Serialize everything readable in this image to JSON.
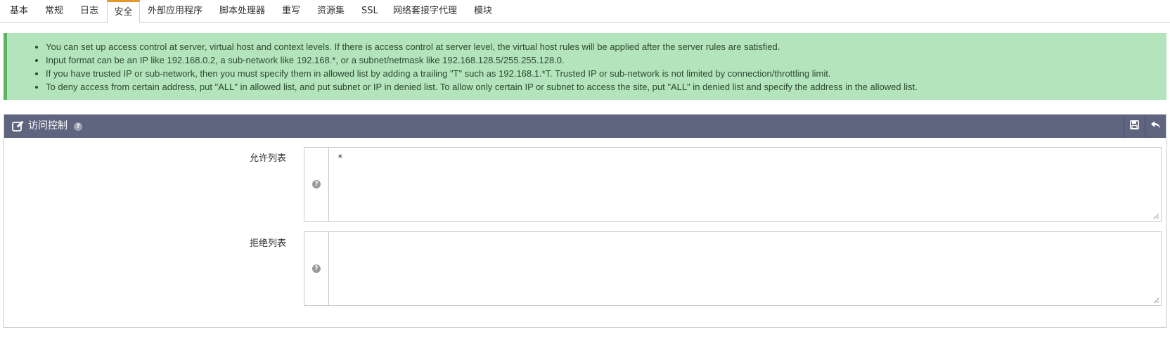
{
  "tabs": [
    {
      "label": "基本"
    },
    {
      "label": "常规"
    },
    {
      "label": "日志"
    },
    {
      "label": "安全"
    },
    {
      "label": "外部应用程序"
    },
    {
      "label": "脚本处理器"
    },
    {
      "label": "重写"
    },
    {
      "label": "资源集"
    },
    {
      "label": "SSL"
    },
    {
      "label": "网络套接字代理"
    },
    {
      "label": "模块"
    }
  ],
  "active_tab": "安全",
  "info": {
    "items": [
      "You can set up access control at server, virtual host and context levels. If there is access control at server level, the virtual host rules will be applied after the server rules are satisfied.",
      "Input format can be an IP like 192.168.0.2, a sub-network like 192.168.*, or a subnet/netmask like 192.168.128.5/255.255.128.0.",
      "If you have trusted IP or sub-network, then you must specify them in allowed list by adding a trailing \"T\" such as 192.168.1.*T. Trusted IP or sub-network is not limited by connection/throttling limit.",
      "To deny access from certain address, put \"ALL\" in allowed list, and put subnet or IP in denied list. To allow only certain IP or subnet to access the site, put \"ALL\" in denied list and specify the address in the allowed list."
    ]
  },
  "panel": {
    "title": "访问控制",
    "icons": {
      "title": "edit-icon",
      "help": "question-icon",
      "save": "save-icon",
      "revert": "undo-icon"
    },
    "fields": {
      "allowed": {
        "label": "允许列表",
        "value": "*"
      },
      "denied": {
        "label": "拒绝列表",
        "value": ""
      }
    }
  },
  "colors": {
    "tab_accent": "#e8952c",
    "info_bg": "#b3e4bb",
    "info_border": "#5cb462",
    "panel_header": "#5f647f"
  }
}
